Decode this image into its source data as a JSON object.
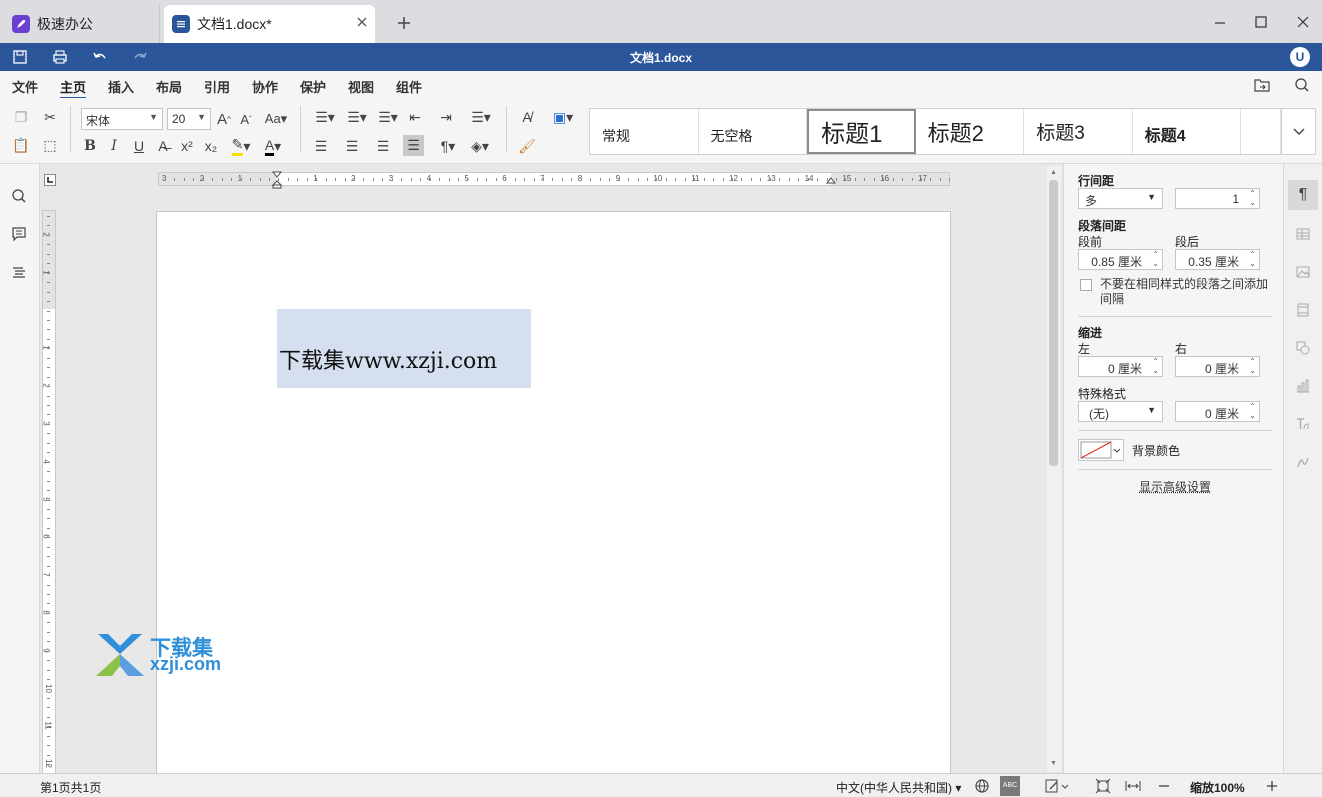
{
  "tabs": {
    "home_label": "极速办公",
    "doc_label": "文档1.docx*"
  },
  "titlebar": {
    "title": "文档1.docx",
    "avatar": "U"
  },
  "menu": [
    "文件",
    "主页",
    "插入",
    "布局",
    "引用",
    "协作",
    "保护",
    "视图",
    "组件"
  ],
  "menu_active": "主页",
  "font": {
    "family": "宋体",
    "size": "20"
  },
  "styles": [
    "常规",
    "无空格",
    "标题1",
    "标题2",
    "标题3",
    "标题4"
  ],
  "document": {
    "text": "下载集www.xzji.com"
  },
  "ruler": {
    "h_ticks": [
      "3",
      "2",
      "1",
      "1",
      "2",
      "3",
      "4",
      "5",
      "6",
      "7",
      "8",
      "9",
      "10",
      "11",
      "12",
      "13",
      "14",
      "15",
      "16",
      "17"
    ],
    "v_ticks": [
      "2",
      "1",
      "1",
      "2",
      "3",
      "4",
      "5",
      "6",
      "7",
      "8",
      "9",
      "10",
      "11",
      "12"
    ]
  },
  "panel": {
    "line_spacing_label": "行间距",
    "line_spacing_mode": "多",
    "line_spacing_value": "1",
    "para_spacing_label": "段落间距",
    "before_label": "段前",
    "after_label": "段后",
    "before_value": "0.85 厘米",
    "after_value": "0.35 厘米",
    "no_space_checkbox": "不要在相同样式的段落之间添加间隔",
    "indent_label": "缩进",
    "left_label": "左",
    "right_label": "右",
    "left_value": "0 厘米",
    "right_value": "0 厘米",
    "special_label": "特殊格式",
    "special_value": "(无)",
    "special_indent_value": "0 厘米",
    "bg_color_label": "背景颜色",
    "advanced_link": "显示高级设置"
  },
  "status": {
    "page_info": "第1页共1页",
    "language": "中文(中华人民共和国)",
    "zoom": "缩放100%"
  },
  "watermark": {
    "title": "下载集",
    "url": "xzji.com"
  },
  "colors": {
    "title_bar": "#2b579a",
    "selection": "#d5dff0",
    "accent": "#2b579a"
  }
}
